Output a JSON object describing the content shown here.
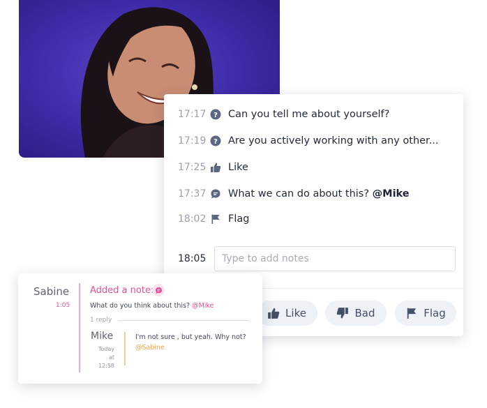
{
  "timeline": [
    {
      "time": "17:17",
      "icon": "question-icon",
      "text": "Can you tell me about yourself?"
    },
    {
      "time": "17:19",
      "icon": "question-icon",
      "text": "Are you actively working with any other..."
    },
    {
      "time": "17:25",
      "icon": "thumbs-up-icon",
      "text": "Like"
    },
    {
      "time": "17:37",
      "icon": "chat-icon",
      "text": "What we can do about this?",
      "mention": "@Mike"
    },
    {
      "time": "18:02",
      "icon": "flag-icon",
      "text": "Flag"
    }
  ],
  "note": {
    "time": "18:05",
    "placeholder": "Type to add notes"
  },
  "actions": {
    "like": "Like",
    "bad": "Bad",
    "flag": "Flag"
  },
  "comment": {
    "author": "Sabine",
    "time": "1:05",
    "label": "Added a note:",
    "message": "What do you think about this?",
    "mention": "@Mike",
    "reply_count": "1 reply",
    "reply": {
      "author": "Mike",
      "time_line1": "Today",
      "time_line2": "at 12:58",
      "text": "I'm not sure , but yeah. Why not?",
      "mention": "@Sabine"
    }
  },
  "colors": {
    "accent_pink": "#e0519a",
    "accent_orange": "#f2a24b",
    "text_dark": "#222b3a",
    "icon_gray": "#5b6780"
  }
}
